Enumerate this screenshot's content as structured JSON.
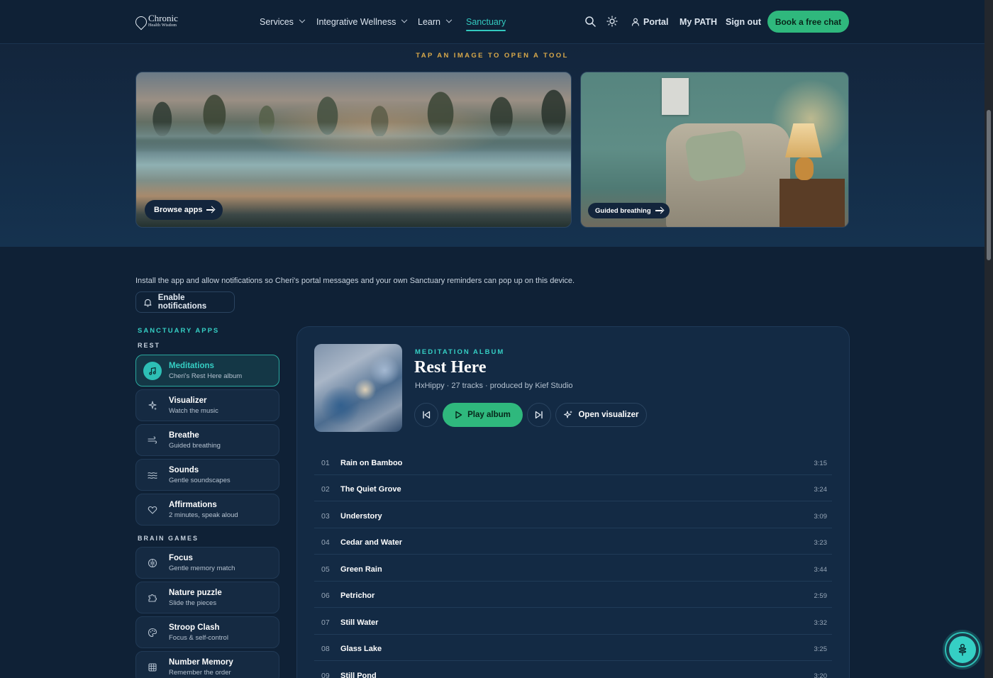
{
  "header": {
    "logo_name": "Chronic",
    "logo_sub": "Health Wisdom",
    "nav": [
      {
        "label": "Services",
        "has_menu": true
      },
      {
        "label": "Integrative Wellness",
        "has_menu": true
      },
      {
        "label": "Learn",
        "has_menu": true
      },
      {
        "label": "Sanctuary",
        "has_menu": false,
        "active": true
      }
    ],
    "portal": "Portal",
    "my_path": "My PATH",
    "sign_out": "Sign out",
    "cta": "Book a free chat"
  },
  "hero": {
    "tagline": "TAP AN IMAGE TO OPEN A TOOL",
    "tiles": [
      {
        "label": "Browse apps",
        "icon": "arrow-right-icon"
      },
      {
        "label": "Guided breathing",
        "icon": "arrow-right-icon"
      }
    ]
  },
  "notice": {
    "text": "Install the app and allow notifications so Cheri's portal messages and your own Sanctuary reminders can pop up on this device.",
    "button": "Enable notifications"
  },
  "sidebar": {
    "heading": "SANCTUARY APPS",
    "groups": [
      {
        "label": "REST",
        "items": [
          {
            "title": "Meditations",
            "subtitle": "Cheri's Rest Here album",
            "icon": "music-note-icon",
            "active": true
          },
          {
            "title": "Visualizer",
            "subtitle": "Watch the music",
            "icon": "sparkles-icon"
          },
          {
            "title": "Breathe",
            "subtitle": "Guided breathing",
            "icon": "wind-icon"
          },
          {
            "title": "Sounds",
            "subtitle": "Gentle soundscapes",
            "icon": "waves-icon"
          },
          {
            "title": "Affirmations",
            "subtitle": "2 minutes, speak aloud",
            "icon": "heart-icon"
          }
        ]
      },
      {
        "label": "BRAIN GAMES",
        "items": [
          {
            "title": "Focus",
            "subtitle": "Gentle memory match",
            "icon": "brain-icon"
          },
          {
            "title": "Nature puzzle",
            "subtitle": "Slide the pieces",
            "icon": "puzzle-icon"
          },
          {
            "title": "Stroop Clash",
            "subtitle": "Focus & self-control",
            "icon": "palette-icon"
          },
          {
            "title": "Number Memory",
            "subtitle": "Remember the order",
            "icon": "grid-icon"
          }
        ]
      }
    ]
  },
  "album": {
    "kicker": "MEDITATION ALBUM",
    "title": "Rest Here",
    "meta": "HxHippy · 27 tracks · produced by Kief Studio",
    "play": "Play album",
    "visualizer": "Open visualizer",
    "tracks": [
      {
        "num": "01",
        "name": "Rain on Bamboo",
        "dur": "3:15"
      },
      {
        "num": "02",
        "name": "The Quiet Grove",
        "dur": "3:24"
      },
      {
        "num": "03",
        "name": "Understory",
        "dur": "3:09"
      },
      {
        "num": "04",
        "name": "Cedar and Water",
        "dur": "3:23"
      },
      {
        "num": "05",
        "name": "Green Rain",
        "dur": "3:44"
      },
      {
        "num": "06",
        "name": "Petrichor",
        "dur": "2:59"
      },
      {
        "num": "07",
        "name": "Still Water",
        "dur": "3:32"
      },
      {
        "num": "08",
        "name": "Glass Lake",
        "dur": "3:25"
      },
      {
        "num": "09",
        "name": "Still Pond",
        "dur": "3:20"
      }
    ]
  },
  "colors": {
    "background": "#0f2136",
    "accent_teal": "#35cfc4",
    "accent_green": "#2fb87d",
    "accent_gold": "#d9a94a"
  }
}
